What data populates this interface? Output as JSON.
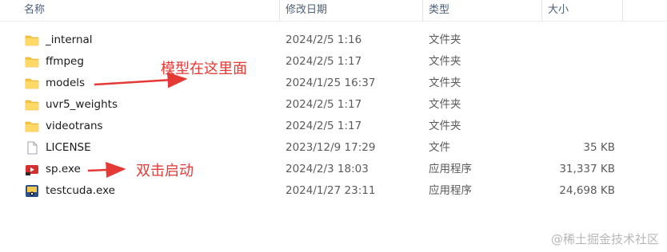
{
  "columns": {
    "name": "名称",
    "date": "修改日期",
    "type": "类型",
    "size": "大小"
  },
  "sort_indicator": "^",
  "files": [
    {
      "name": "_internal",
      "date": "2024/2/5 1:16",
      "type": "文件夹",
      "size": "",
      "icon": "folder-icon"
    },
    {
      "name": "ffmpeg",
      "date": "2024/2/5 1:17",
      "type": "文件夹",
      "size": "",
      "icon": "folder-icon"
    },
    {
      "name": "models",
      "date": "2024/1/25 16:37",
      "type": "文件夹",
      "size": "",
      "icon": "folder-icon"
    },
    {
      "name": "uvr5_weights",
      "date": "2024/2/5 1:17",
      "type": "文件夹",
      "size": "",
      "icon": "folder-icon"
    },
    {
      "name": "videotrans",
      "date": "2024/2/5 1:17",
      "type": "文件夹",
      "size": "",
      "icon": "folder-icon"
    },
    {
      "name": "LICENSE",
      "date": "2023/12/9 17:29",
      "type": "文件",
      "size": "35 KB",
      "icon": "file-icon"
    },
    {
      "name": "sp.exe",
      "date": "2024/2/3 18:03",
      "type": "应用程序",
      "size": "31,337 KB",
      "icon": "app-sp-icon"
    },
    {
      "name": "testcuda.exe",
      "date": "2024/1/27 23:11",
      "type": "应用程序",
      "size": "24,698 KB",
      "icon": "app-testcuda-icon"
    }
  ],
  "annotations": {
    "models_note": "模型在这里面",
    "sp_note": "双击启动"
  },
  "watermark": "@稀土掘金技术社区",
  "colors": {
    "annotation": "#e53935",
    "folder": "#f5c542",
    "header_text": "#4c607a"
  }
}
